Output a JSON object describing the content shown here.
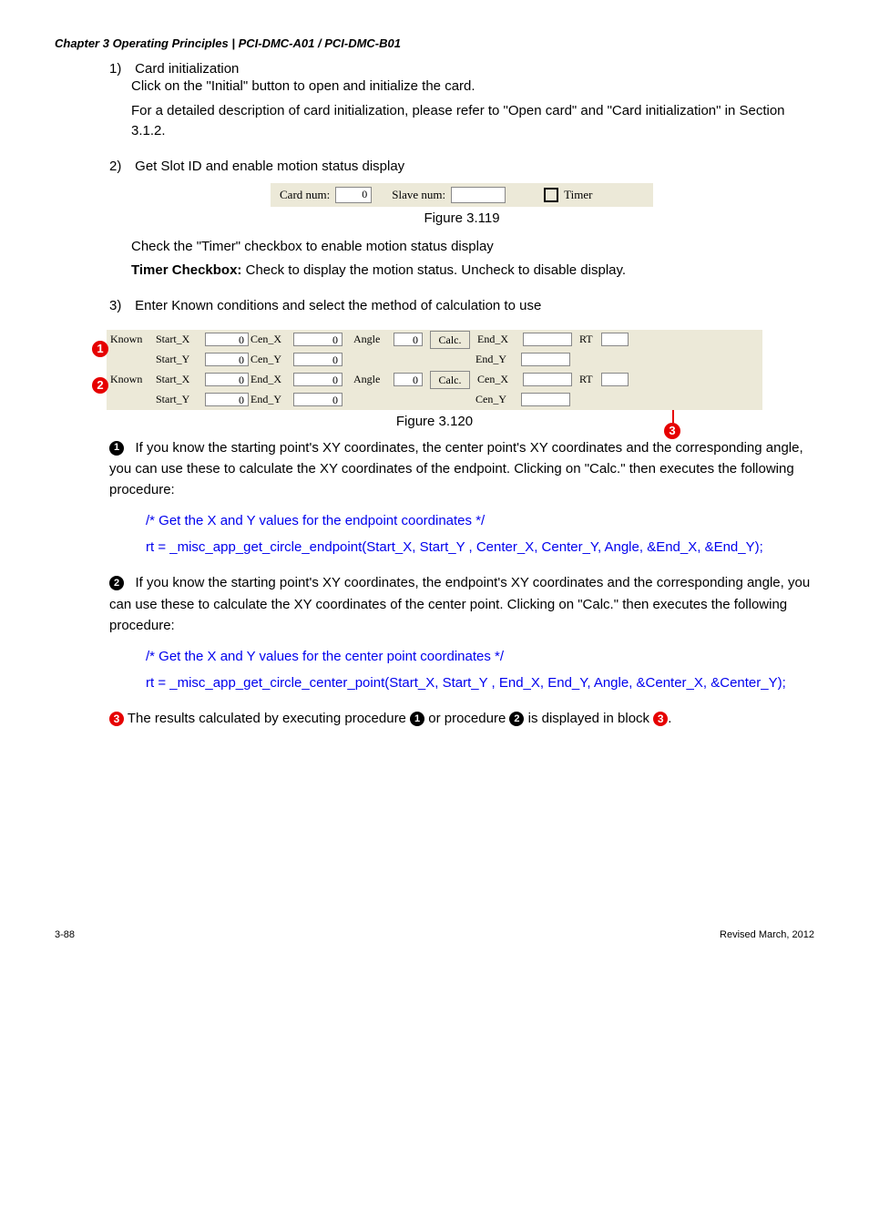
{
  "chapter": "Chapter 3 Operating Principles | PCI-DMC-A01 / PCI-DMC-B01",
  "s1": {
    "num": "1)",
    "title": "Card initialization",
    "p1": "Click on the \"Initial\" button to open and initialize the card.",
    "p2": "For a detailed description of card initialization, please refer to \"Open card\" and \"Card initialization\" in Section 3.1.2."
  },
  "s2": {
    "num": "2)",
    "title": "Get Slot ID and enable motion status display",
    "card_num_label": "Card num:",
    "card_num_val": "0",
    "slave_num_label": "Slave num:",
    "timer_label": "Timer",
    "fig": "Figure 3.119",
    "p1": "Check the \"Timer\" checkbox to enable motion status display",
    "p2_strong": "Timer Checkbox:",
    "p2_rest": " Check to display the motion status. Uncheck to disable display."
  },
  "s3": {
    "num": "3)",
    "title": "Enter Known conditions and select the method of calculation to use",
    "r1": {
      "known": "Known",
      "sxl": "Start_X",
      "sxv": "0",
      "cxl": "Cen_X",
      "cxv": "0",
      "anglel": "Angle",
      "anglev": "0",
      "calc": "Calc.",
      "exl": "End_X",
      "rtl": "RT"
    },
    "r2": {
      "syl": "Start_Y",
      "syv": "0",
      "cyl": "Cen_Y",
      "cyv": "0",
      "eyl": "End_Y"
    },
    "r3": {
      "known": "Known",
      "sxl": "Start_X",
      "sxv": "0",
      "exl": "End_X",
      "exv": "0",
      "anglel": "Angle",
      "anglev": "0",
      "calc": "Calc.",
      "cxl": "Cen_X",
      "rtl": "RT"
    },
    "r4": {
      "syl": "Start_Y",
      "syv": "0",
      "eyl": "End_Y",
      "eyv": "0",
      "cyl": "Cen_Y"
    },
    "fig": "Figure 3.120"
  },
  "bullets": {
    "b1": "1",
    "b2": "2",
    "b3": "3",
    "n1": "❶",
    "n2": "❷",
    "n3": "❸",
    "p1": "If you know the starting point's XY coordinates, the center point's XY coordinates and the corresponding angle, you can use these to calculate the XY coordinates of the endpoint. Clicking on \"Calc.\" then executes the following procedure:",
    "c1a": "/* Get the X and Y values for the endpoint coordinates */",
    "c1b": "rt = _misc_app_get_circle_endpoint(Start_X, Start_Y , Center_X, Center_Y, Angle, &End_X, &End_Y);",
    "p2": "If you know the starting point's XY coordinates, the endpoint's XY coordinates and the corresponding angle, you can use these to calculate the XY coordinates of the center point. Clicking on \"Calc.\" then executes the following procedure:",
    "c2a": "/* Get the X and Y values for the center point coordinates */",
    "c2b": "rt = _misc_app_get_circle_center_point(Start_X, Start_Y , End_X, End_Y, Angle, &Center_X, &Center_Y);",
    "p3a": " The results calculated by executing procedure ",
    "p3b": " or procedure ",
    "p3c": " is displayed in block ",
    "p3d": "."
  },
  "footer": {
    "left": "3-88",
    "right": "Revised March, 2012"
  }
}
